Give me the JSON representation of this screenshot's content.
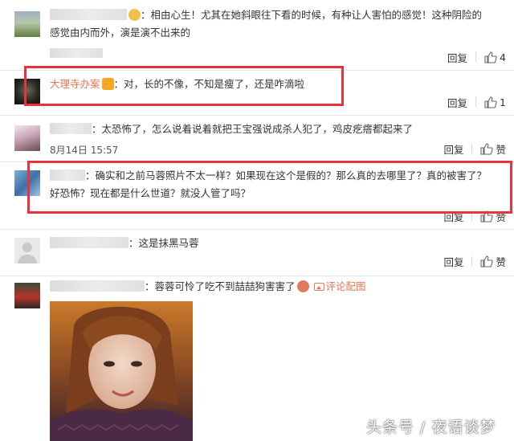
{
  "comments": [
    {
      "line1": "：相由心生！尤其在她斜眼往下看的时候，有种让人害怕的感觉！这种阴险的",
      "line2": "感觉由内而外，演是演不出来的",
      "reply": "回复",
      "likes": "4"
    },
    {
      "name": "大理寺办案",
      "text": "：对，长的不像，不知是瘦了，还是咋滴啦",
      "reply": "回复",
      "likes": "1"
    },
    {
      "text": "：太恐怖了，怎么说着说着就把王宝强说成杀人犯了，鸡皮疙瘩都起来了",
      "date": "8月14日 15:57",
      "reply": "回复",
      "likes": "赞"
    },
    {
      "line1": "：确实和之前马蓉照片不太一样？如果现在这个是假的？那么真的去哪里了？真的被害了？",
      "line2": "好恐怖？现在都是什么世道？就没人管了吗？",
      "reply": "回复",
      "likes": "赞"
    },
    {
      "text": "：这是抹黑马蓉",
      "reply": "回复",
      "likes": "赞"
    },
    {
      "text": "：蓉蓉可怜了吃不到喆喆狗害害了",
      "view_image": "评论配图"
    }
  ],
  "watermark": "头条号 / 夜语谈梦",
  "colors": {
    "accent": "#eb7350",
    "highlight_box": "#e8323c"
  }
}
